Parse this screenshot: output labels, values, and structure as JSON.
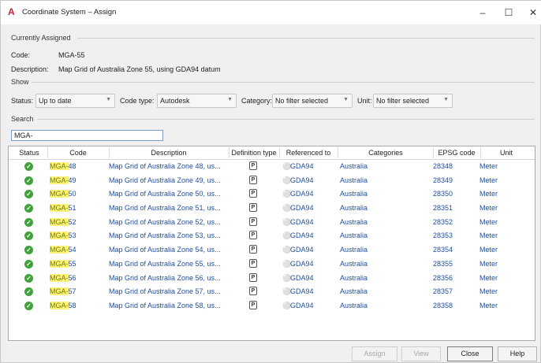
{
  "window": {
    "title": "Coordinate System – Assign",
    "logo": "A",
    "minimize": "–",
    "maximize": "☐",
    "close": "✕"
  },
  "currently_assigned": {
    "heading": "Currently Assigned",
    "code_label": "Code:",
    "code_value": "MGA-55",
    "description_label": "Description:",
    "description_value": "Map Grid of Australia Zone 55, using GDA94 datum"
  },
  "show": {
    "heading": "Show",
    "status_label": "Status:",
    "status_value": "Up to date",
    "code_type_label": "Code type:",
    "code_type_value": "Autodesk",
    "category_label": "Category:",
    "category_value": "No filter selected",
    "unit_label": "Unit:",
    "unit_value": "No filter selected"
  },
  "search": {
    "heading": "Search",
    "value": "MGA-"
  },
  "table": {
    "columns": [
      "Status",
      "Code",
      "Description",
      "Definition type",
      "Referenced to",
      "Categories",
      "EPSG code",
      "Unit"
    ],
    "rows": [
      {
        "code_match": "MGA-",
        "code_rest": "48",
        "description": "Map Grid of Australia Zone 48, us...",
        "deftype": "P",
        "referenced": "GDA94",
        "category": "Australia",
        "epsg": "28348",
        "unit": "Meter"
      },
      {
        "code_match": "MGA-",
        "code_rest": "49",
        "description": "Map Grid of Australia Zone 49, us...",
        "deftype": "P",
        "referenced": "GDA94",
        "category": "Australia",
        "epsg": "28349",
        "unit": "Meter"
      },
      {
        "code_match": "MGA-",
        "code_rest": "50",
        "description": "Map Grid of Australia Zone 50, us...",
        "deftype": "P",
        "referenced": "GDA94",
        "category": "Australia",
        "epsg": "28350",
        "unit": "Meter"
      },
      {
        "code_match": "MGA-",
        "code_rest": "51",
        "description": "Map Grid of Australia Zone 51, us...",
        "deftype": "P",
        "referenced": "GDA94",
        "category": "Australia",
        "epsg": "28351",
        "unit": "Meter"
      },
      {
        "code_match": "MGA-",
        "code_rest": "52",
        "description": "Map Grid of Australia Zone 52, us...",
        "deftype": "P",
        "referenced": "GDA94",
        "category": "Australia",
        "epsg": "28352",
        "unit": "Meter"
      },
      {
        "code_match": "MGA-",
        "code_rest": "53",
        "description": "Map Grid of Australia Zone 53, us...",
        "deftype": "P",
        "referenced": "GDA94",
        "category": "Australia",
        "epsg": "28353",
        "unit": "Meter"
      },
      {
        "code_match": "MGA-",
        "code_rest": "54",
        "description": "Map Grid of Australia Zone 54, us...",
        "deftype": "P",
        "referenced": "GDA94",
        "category": "Australia",
        "epsg": "28354",
        "unit": "Meter"
      },
      {
        "code_match": "MGA-",
        "code_rest": "55",
        "description": "Map Grid of Australia Zone 55, us...",
        "deftype": "P",
        "referenced": "GDA94",
        "category": "Australia",
        "epsg": "28355",
        "unit": "Meter"
      },
      {
        "code_match": "MGA-",
        "code_rest": "56",
        "description": "Map Grid of Australia Zone 56, us...",
        "deftype": "P",
        "referenced": "GDA94",
        "category": "Australia",
        "epsg": "28356",
        "unit": "Meter"
      },
      {
        "code_match": "MGA-",
        "code_rest": "57",
        "description": "Map Grid of Australia Zone 57, us...",
        "deftype": "P",
        "referenced": "GDA94",
        "category": "Australia",
        "epsg": "28357",
        "unit": "Meter"
      },
      {
        "code_match": "MGA-",
        "code_rest": "58",
        "description": "Map Grid of Australia Zone 58, us...",
        "deftype": "P",
        "referenced": "GDA94",
        "category": "Australia",
        "epsg": "28358",
        "unit": "Meter"
      }
    ]
  },
  "buttons": {
    "assign": "Assign",
    "view": "View",
    "close": "Close",
    "help": "Help"
  },
  "colors": {
    "status_ok": "#3fa33a",
    "highlight": "#fff27a",
    "link_text": "#1f4e9a"
  }
}
